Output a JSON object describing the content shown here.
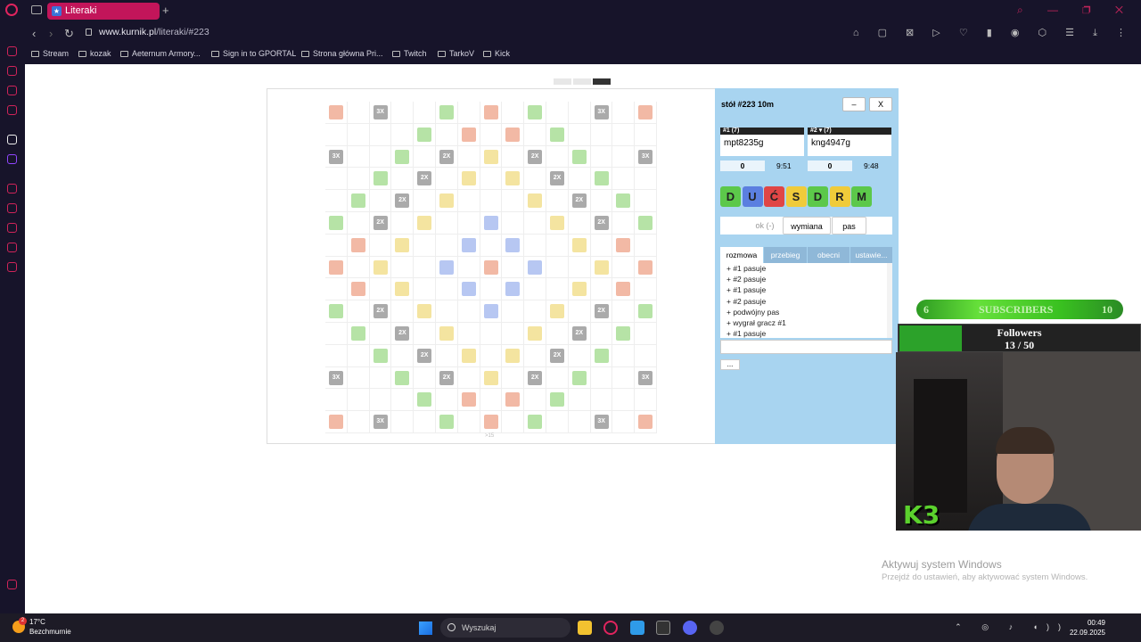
{
  "browser": {
    "tab_title": "Literaki",
    "url_domain": "www.kurnik.pl",
    "url_path": "/literaki/#223",
    "bookmarks": [
      "Stream",
      "kozak",
      "Aeternum Armory...",
      "Sign in to GPORTAL",
      "Strona główna Pri...",
      "Twitch",
      "TarkoV",
      "Kick"
    ]
  },
  "board": {
    "size": 15,
    "footer": ">15",
    "bonus_labels": {
      "tw": "3X",
      "dw": "2X"
    }
  },
  "panel": {
    "table_title": "stół #223   10m",
    "minimize_label": "–",
    "close_label": "X",
    "players": [
      {
        "header": "#1   (7)",
        "name": "mpt8235g",
        "score": "0",
        "time": "9:51"
      },
      {
        "header": "#2 ▾ (7)",
        "name": "kng4947g",
        "score": "0",
        "time": "9:48"
      }
    ],
    "rack": [
      {
        "letter": "D",
        "color": "#5cc84a"
      },
      {
        "letter": "U",
        "color": "#5b7fe0"
      },
      {
        "letter": "Ć",
        "color": "#e04646"
      },
      {
        "letter": "S",
        "color": "#f0cb3a"
      },
      {
        "letter": "D",
        "color": "#5cc84a"
      },
      {
        "letter": "R",
        "color": "#f0cb3a"
      },
      {
        "letter": "M",
        "color": "#5cc84a"
      }
    ],
    "actions": {
      "ok": "ok (-)",
      "exchange": "wymiana",
      "pass": "pas"
    },
    "tabs": [
      "rozmowa",
      "przebieg",
      "obecni",
      "ustawie..."
    ],
    "log": [
      "+ #1 pasuje",
      "+ #2 pasuje",
      "+ #1 pasuje",
      "+ #2 pasuje",
      "+ podwójny pas",
      "+ wygrał gracz #1",
      "+ #1 pasuje"
    ],
    "more_label": "..."
  },
  "overlay": {
    "subs_current": "6",
    "subs_label": "SUBSCRIBERS",
    "subs_goal": "10",
    "followers_label": "Followers",
    "followers_count": "13 / 50",
    "followers_fill": 0.26,
    "webcam_logo": "K3"
  },
  "watermark": {
    "title": "Aktywuj system Windows",
    "subtitle": "Przejdź do ustawień, aby aktywować system Windows."
  },
  "taskbar": {
    "weather_temp": "17°C",
    "weather_desc": "Bezchmurnie",
    "weather_badge": "2",
    "search_placeholder": "Wyszukaj",
    "time": "00:49",
    "date": "22.09.2025"
  }
}
